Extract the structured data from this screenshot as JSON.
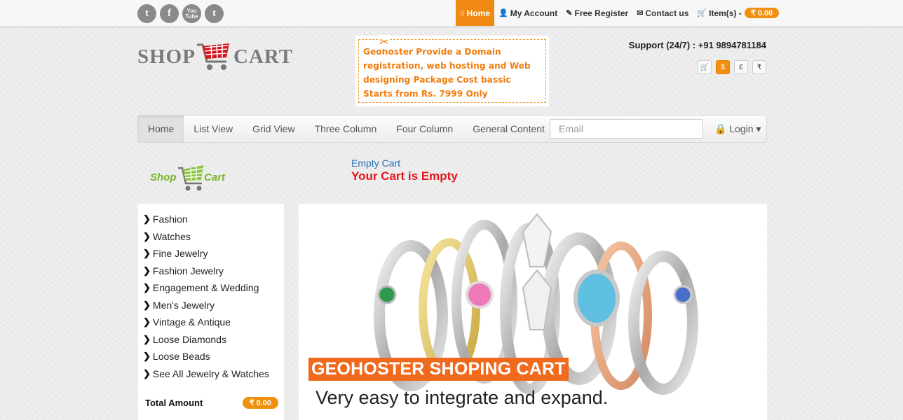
{
  "social": [
    {
      "name": "twitter",
      "glyph": "t"
    },
    {
      "name": "facebook",
      "glyph": "f"
    },
    {
      "name": "youtube",
      "glyph": "You Tube"
    },
    {
      "name": "tumblr",
      "glyph": "t"
    }
  ],
  "topnav": {
    "home": "Home",
    "my_account": "My Account",
    "free_register": "Free Register",
    "contact_us": "Contact us",
    "items": "Item(s) -",
    "items_amount": "₹ 0.00"
  },
  "logo": {
    "left": "SHOP",
    "right": "CART"
  },
  "promo": {
    "text": "Geohoster Provide a Domain registration, web hosting and Web designing Package Cost bassic Starts from Rs. 7999 Only"
  },
  "support": {
    "text": "Support (24/7) : +91 9894781184"
  },
  "currency": [
    {
      "name": "cart",
      "glyph": "🛒",
      "active": false
    },
    {
      "name": "dollar",
      "glyph": "$",
      "active": true
    },
    {
      "name": "pound",
      "glyph": "£",
      "active": false
    },
    {
      "name": "rupee",
      "glyph": "₹",
      "active": false
    }
  ],
  "mainnav": {
    "items": [
      "Home",
      "List View",
      "Grid View",
      "Three Column",
      "Four Column",
      "General Content"
    ],
    "email_placeholder": "Email",
    "login": "Login"
  },
  "small_logo": {
    "left": "Shop",
    "right": "Cart"
  },
  "cart": {
    "link": "Empty Cart",
    "message": "Your Cart is Empty"
  },
  "categories": [
    "Fashion",
    "Watches",
    "Fine Jewelry",
    "Fashion Jewelry",
    "Engagement & Wedding",
    "Men's Jewelry",
    "Vintage & Antique",
    "Loose Diamonds",
    "Loose Beads",
    "See All Jewelry & Watches"
  ],
  "total": {
    "label": "Total Amount",
    "amount": "₹ 0.00"
  },
  "banner": {
    "caption": "GEOHOSTER SHOPING CART",
    "subtitle": "Very easy to integrate and expand."
  },
  "colors": {
    "accent": "#f0900f",
    "caption_bg": "#f06a1e",
    "cart_empty": "#e4151a",
    "link": "#2a6fb0"
  }
}
